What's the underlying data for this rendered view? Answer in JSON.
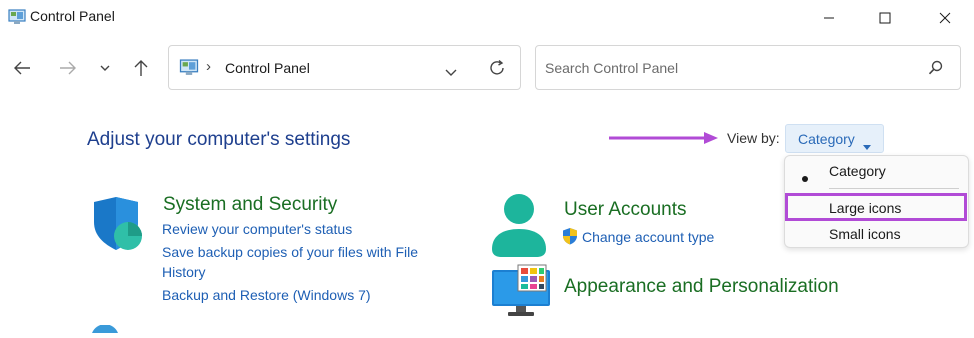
{
  "window": {
    "title": "Control Panel",
    "controls": [
      "minimize-icon",
      "maximize-icon",
      "close-icon"
    ]
  },
  "nav": {
    "address": {
      "breadcrumb_separator": "›",
      "location": "Control Panel"
    },
    "search": {
      "placeholder": "Search Control Panel"
    }
  },
  "main": {
    "heading": "Adjust your computer's settings",
    "view_by": {
      "label": "View by:",
      "selected": "Category",
      "options": [
        {
          "label": "Category",
          "selected": true
        },
        {
          "label": "Large icons",
          "highlighted": true
        },
        {
          "label": "Small icons"
        }
      ]
    },
    "categories": [
      {
        "title": "System and Security",
        "icon": "shield-icon",
        "links": [
          "Review your computer's status",
          "Save backup copies of your files with File",
          "History",
          "Backup and Restore (Windows 7)"
        ]
      },
      {
        "title": "User Accounts",
        "icon": "user-icon",
        "links": [
          "Change account type"
        ]
      },
      {
        "title": "Appearance and Personalization",
        "icon": "monitor-icon",
        "links": []
      }
    ]
  },
  "colors": {
    "heading": "#1e3f8e",
    "category_title": "#1a6e23",
    "link": "#1e5fb4",
    "annotation": "#b14bd6"
  }
}
